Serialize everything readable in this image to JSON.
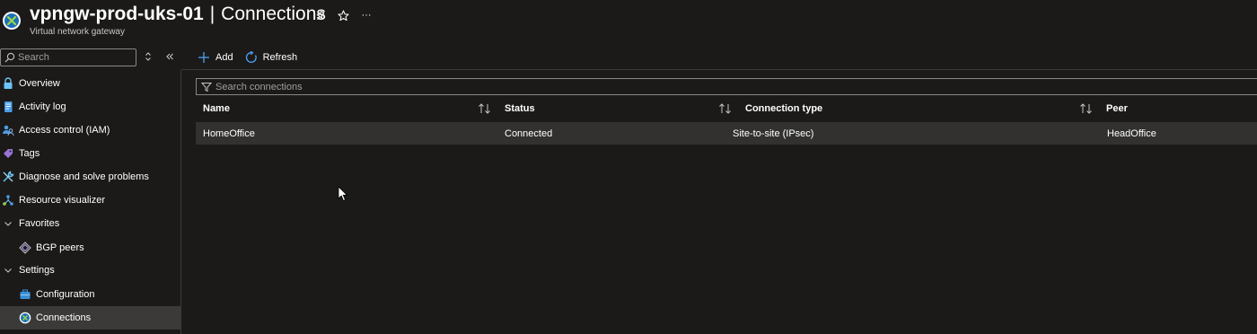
{
  "header": {
    "resource_name": "vpngw-prod-uks-01",
    "separator": "|",
    "page_title": "Connections",
    "resource_type": "Virtual network gateway",
    "pin_icon": "pin-icon",
    "favorite_icon": "star-icon",
    "more_icon": "more-icon",
    "more_label": "···"
  },
  "sidebar": {
    "search_placeholder": "Search",
    "items": [
      {
        "label": "Overview",
        "icon": "lock-icon"
      },
      {
        "label": "Activity log",
        "icon": "activity-log-icon"
      },
      {
        "label": "Access control (IAM)",
        "icon": "iam-icon"
      },
      {
        "label": "Tags",
        "icon": "tag-icon"
      },
      {
        "label": "Diagnose and solve problems",
        "icon": "wrench-icon"
      },
      {
        "label": "Resource visualizer",
        "icon": "visualizer-icon"
      },
      {
        "label": "Favorites",
        "icon": "chevron-down-icon"
      },
      {
        "label": "BGP peers",
        "icon": "bgp-icon"
      },
      {
        "label": "Settings",
        "icon": "chevron-down-icon"
      },
      {
        "label": "Configuration",
        "icon": "configuration-icon"
      },
      {
        "label": "Connections",
        "icon": "connections-icon"
      }
    ]
  },
  "toolbar": {
    "add_label": "Add",
    "refresh_label": "Refresh"
  },
  "filter": {
    "placeholder": "Search connections"
  },
  "table": {
    "columns": [
      "Name",
      "Status",
      "Connection type",
      "Peer"
    ],
    "rows": [
      [
        "HomeOffice",
        "Connected",
        "Site-to-site (IPsec)",
        "HeadOffice"
      ]
    ]
  },
  "colors": {
    "background": "#1b1a19",
    "selected_row": "#323130",
    "accent": "#0078d4"
  }
}
